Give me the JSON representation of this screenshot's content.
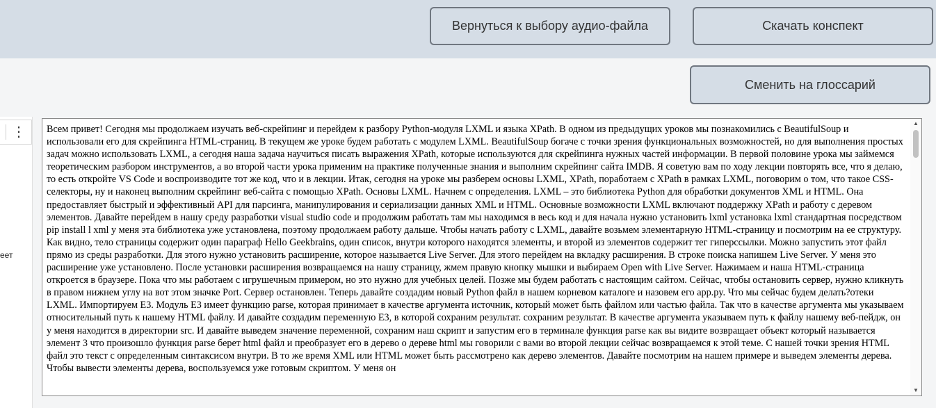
{
  "header": {
    "back_button_label": "Вернуться к выбору аудио-файла",
    "download_button_label": "Скачать конспект"
  },
  "main": {
    "glossary_button_label": "Сменить на глоссарий",
    "transcript_text": "Всем привет! Сегодня мы продолжаем изучать веб-скрейпинг и перейдем к разбору Python-модуля LXML и языка XPath. В одном из предыдущих уроков мы познакомились с BeautifulSoup и использовали его для скрейпинга HTML-страниц. В текущем же уроке будем работать с модулем LXML. BeautifulSoup богаче с точки зрения функциональных возможностей, но для выполнения простых задач можно использовать LXML, а сегодня наша задача научиться писать выражения XPath, которые используются для скрейпинга нужных частей информации. В первой половине урока мы займемся теоретическим разбором инструментов, а во второй части урока применим на практике полученные знания и выполним скрейпинг сайта IMDB. Я советую вам по ходу лекции повторять все, что я делаю, то есть откройте VS Code и воспроизводите тот же код, что и в лекции. Итак, сегодня на уроке мы разберем основы LXML, XPath, поработаем с XPath в рамках LXML, поговорим о том, что такое CSS-селекторы, ну и наконец выполним скрейпинг веб-сайта с помощью XPath. Основы LXML. Начнем с определения. LXML – это библиотека Python для обработки документов XML и HTML. Она предоставляет быстрый и эффективный API для парсинга, манипулирования и сериализации данных XML и HTML. Основные возможности LXML включают поддержку XPath и работу с деревом элементов. Давайте перейдем в нашу среду разработки visual studio code и продолжим работать там мы находимся в весь код и для начала нужно установить lxml установка lxml стандартная посредством pip install l xml у меня эта библиотека уже установлена, поэтому продолжаем работу дальше. Чтобы начать работу с LXML, давайте возьмем элементарную HTML-страницу и посмотрим на ее структуру. Как видно, тело страницы содержит один параграф Hello Geekbrains, один список, внутри которого находятся элементы, и второй из элементов содержит тег гиперссылки. Можно запустить этот файл прямо из среды разработки. Для этого нужно установить расширение, которое называется Live Server. Для этого перейдем на вкладку расширения. В строке поиска напишем Live Server. У меня это расширение уже установлено. После установки расширения возвращаемся на нашу страницу, жмем правую кнопку мышки и выбираем Open with Live Server. Нажимаем и наша HTML-страница откроется в браузере. Пока что мы работаем с игрушечным примером, но это нужно для учебных целей. Позже мы будем работать с настоящим сайтом. Сейчас, чтобы остановить сервер, нужно кликнуть в правом нижнем углу на вот этом значке Port. Сервер остановлен. Теперь давайте создадим новый Python файл в нашем корневом каталоге и назовем его app.py. Что мы сейчас будем делать?отеки LXML. Импортируем E3. Модуль E3 имеет функцию parse, которая принимает в качестве аргумента источник, который может быть файлом или частью файла. Так что в качестве аргумента мы указываем относительный путь к нашему HTML файлу. И давайте создадим переменную E3, в которой сохраним результат. сохраним результат. В качестве аргумента указываем путь к файлу нашему веб-пейдж, он у меня находится в директории src. И давайте выведем значение переменной, сохраним наш скрипт и запустим его в терминале функция parse как вы видите возвращает объект который называется элемент 3 что произошло функция parse берет html файл и преобразует его в дерево о дереве html мы говорили с вами во второй лекции сейчас возвращаемся к этой теме. С нашей точки зрения HTML файл это текст с определенным синтаксисом внутри. В то же время XML или HTML может быть рассмотрено как дерево элементов. Давайте посмотрим на нашем примере и выведем элементы дерева. Чтобы вывести элементы дерева, воспользуемся уже готовым скриптом. У меня он"
  },
  "left_panel": {
    "partial_text": "еет",
    "menu_icon": "kebab-menu-icon"
  },
  "scrollbar": {
    "up_glyph": "▲",
    "down_glyph": "▼"
  }
}
